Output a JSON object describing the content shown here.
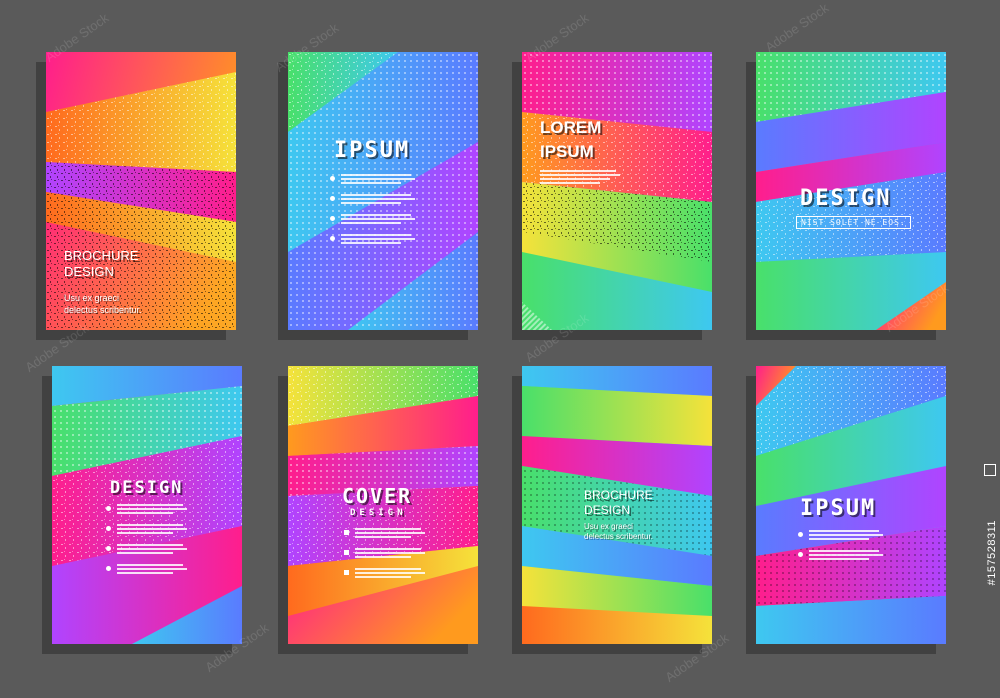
{
  "cards": [
    {
      "title_line1": "BROCHURE",
      "title_line2": "DESIGN",
      "subtitle_line1": "Usu ex graeci",
      "subtitle_line2": "delectus scribentur."
    },
    {
      "title": "IPSUM"
    },
    {
      "title_line1": "LOREM",
      "title_line2": "IPSUM"
    },
    {
      "title": "DESIGN",
      "tagline": "NIST SOLET NE EOS."
    },
    {
      "title": "DESIGN"
    },
    {
      "title": "COVER",
      "subtitle": "DESIGN"
    },
    {
      "title_line1": "BROCHURE",
      "title_line2": "DESIGN",
      "subtitle_line1": "Usu ex graeci",
      "subtitle_line2": "delectus scribentur."
    },
    {
      "title": "IPSUM"
    }
  ],
  "watermark": "Adobe Stock",
  "stock_id": "#157528311",
  "colors": {
    "background": "#5a5a5a",
    "pink": "#ff1e8c",
    "orange": "#ff8a1e",
    "yellow": "#f5e23a",
    "green": "#49e06a",
    "cyan": "#3ec8f0",
    "blue": "#5a7bff",
    "purple": "#b044ff"
  }
}
